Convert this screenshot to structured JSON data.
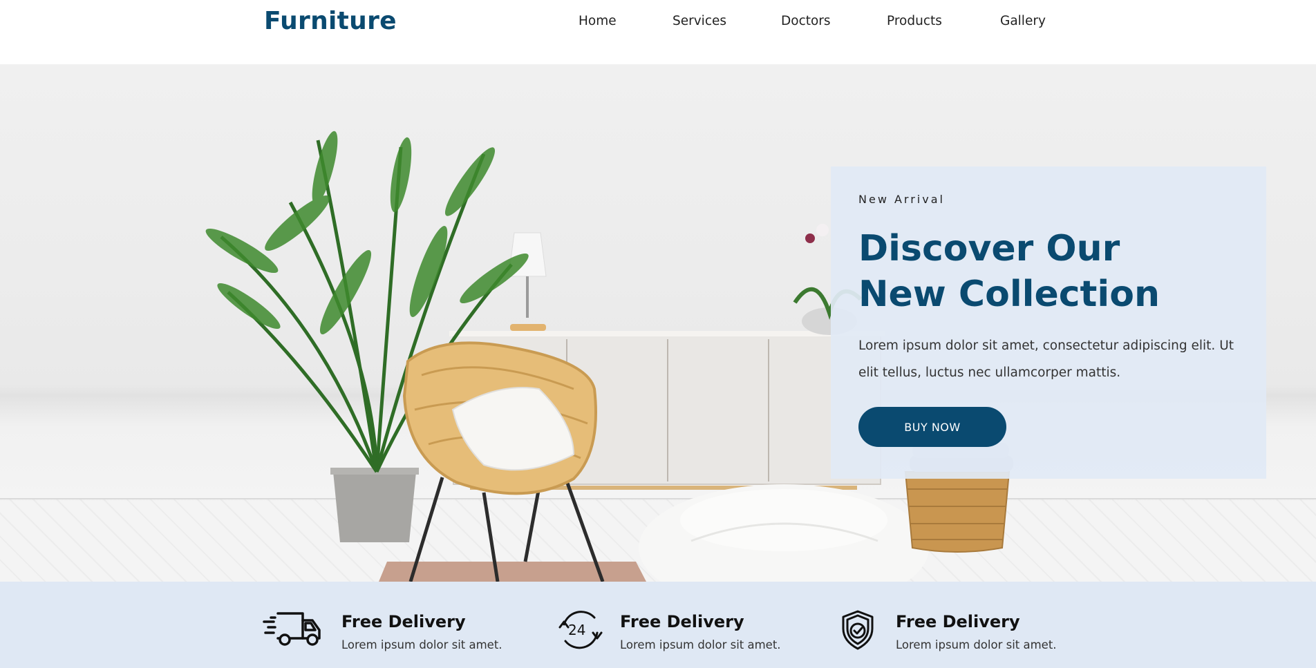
{
  "brand": {
    "logo": "Furniture",
    "accent_color": "#0a4a70"
  },
  "nav": {
    "items": [
      {
        "label": "Home"
      },
      {
        "label": "Services"
      },
      {
        "label": "Doctors"
      },
      {
        "label": "Products"
      },
      {
        "label": "Gallery"
      }
    ]
  },
  "hero": {
    "eyebrow": "New Arrival",
    "headline_line1": "Discover Our",
    "headline_line2": "New Collection",
    "description": "Lorem ipsum dolor sit amet, consectetur adipiscing elit. Ut elit tellus, luctus nec ullamcorper mattis.",
    "cta_label": "BUY NOW",
    "panel_color": "#e1e9f5"
  },
  "features": {
    "background_color": "#dfe8f4",
    "items": [
      {
        "icon": "delivery-truck-icon",
        "title": "Free Delivery",
        "text": "Lorem ipsum dolor sit amet."
      },
      {
        "icon": "24-hour-support-icon",
        "title": "Free Delivery",
        "text": "Lorem ipsum dolor sit amet."
      },
      {
        "icon": "shield-check-icon",
        "title": "Free Delivery",
        "text": "Lorem ipsum dolor sit amet."
      }
    ]
  }
}
